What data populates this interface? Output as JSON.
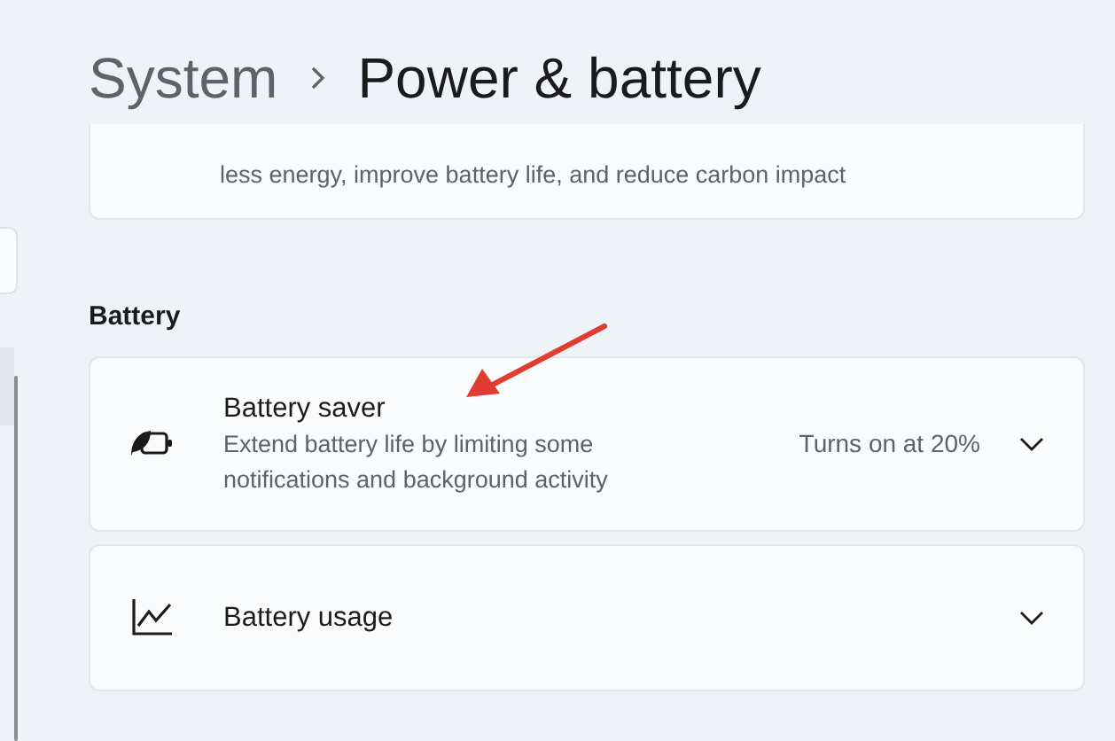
{
  "breadcrumb": [
    {
      "text": "System",
      "current": false
    },
    {
      "text": "Power & battery",
      "current": true
    }
  ],
  "top_card": {
    "description": "less energy, improve battery life, and reduce carbon impact"
  },
  "section": "Battery",
  "settings": [
    {
      "title": "Battery saver",
      "description": "Extend battery life by limiting some notifications and background activity",
      "value": "Turns on at 20%",
      "expanded": false
    },
    {
      "title": "Battery usage",
      "expanded": false
    }
  ]
}
